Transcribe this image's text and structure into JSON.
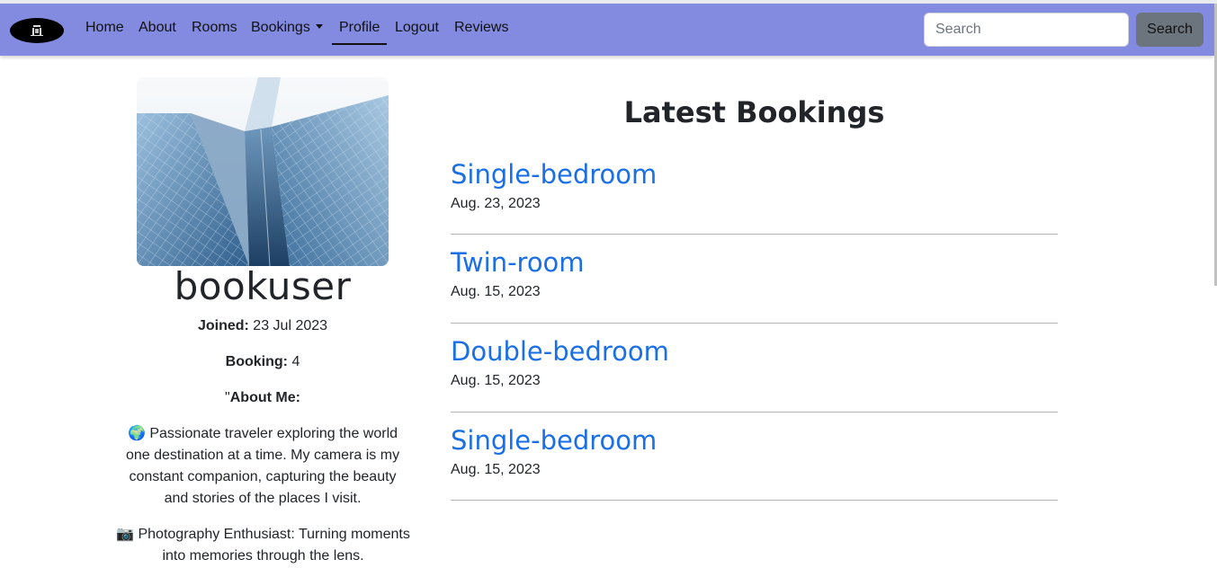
{
  "navbar": {
    "items": [
      {
        "label": "Home"
      },
      {
        "label": "About"
      },
      {
        "label": "Rooms"
      },
      {
        "label": "Bookings"
      },
      {
        "label": "Profile",
        "active": true
      },
      {
        "label": "Logout"
      },
      {
        "label": "Reviews"
      }
    ],
    "search_placeholder": "Search",
    "search_button": "Search",
    "accent_color": "#838be0"
  },
  "profile": {
    "username": "bookuser",
    "joined_label": "Joined:",
    "joined_value": "23 Jul 2023",
    "booking_label": "Booking:",
    "booking_value": "4",
    "about_prefix": "\"",
    "about_label": "About Me:",
    "bio_1": "🌍 Passionate traveler exploring the world one destination at a time. My camera is my constant companion, capturing the beauty and stories of the places I visit.",
    "bio_2": "📷 Photography Enthusiast: Turning moments into memories through the lens."
  },
  "bookings": {
    "title": "Latest Bookings",
    "items": [
      {
        "room": "Single-bedroom",
        "date": "Aug. 23, 2023"
      },
      {
        "room": "Twin-room",
        "date": "Aug. 15, 2023"
      },
      {
        "room": "Double-bedroom",
        "date": "Aug. 15, 2023"
      },
      {
        "room": "Single-bedroom",
        "date": "Aug. 15, 2023"
      }
    ],
    "link_color": "#1a6fe6"
  }
}
